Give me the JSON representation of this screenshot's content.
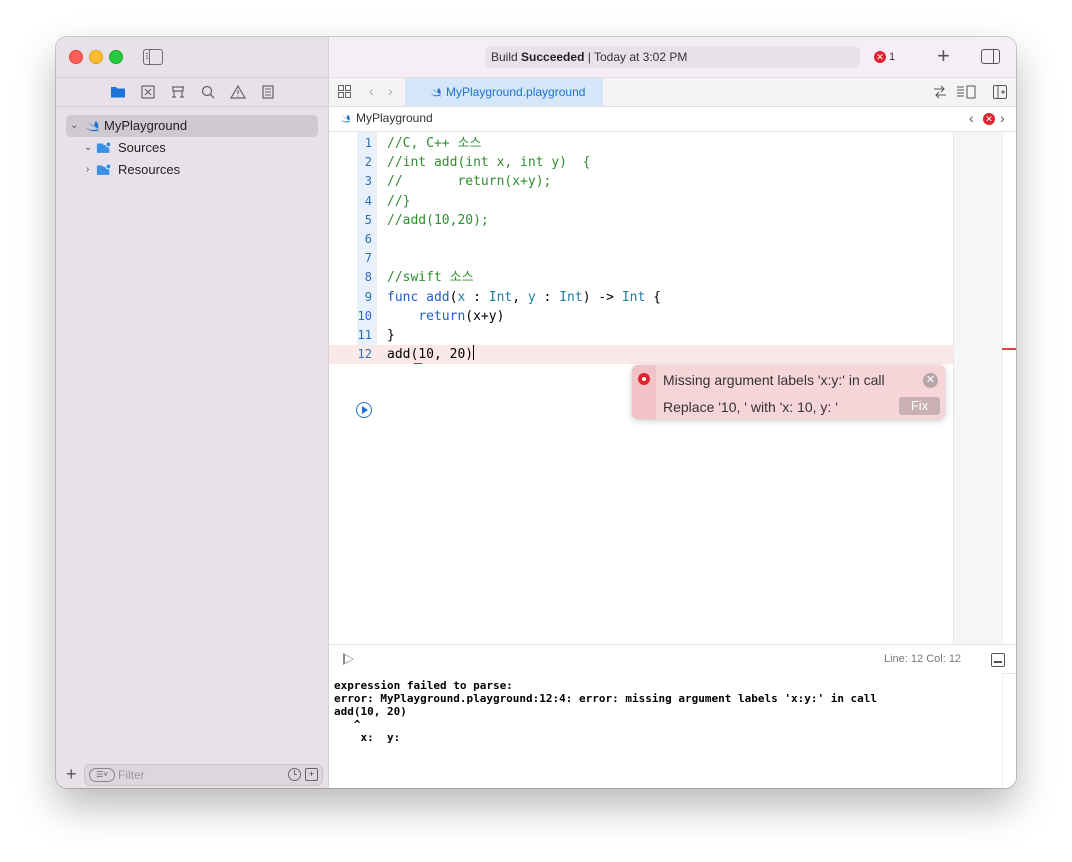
{
  "window": {
    "status": {
      "prefix": "Build ",
      "bold": "Succeeded",
      "suffix": " | Today at 3:02 PM"
    },
    "error_count": "1"
  },
  "sidebar": {
    "tree": [
      {
        "label": "MyPlayground",
        "icon": "swift-icon",
        "expanded": true,
        "selected": true
      },
      {
        "label": "Sources",
        "icon": "folder-icon",
        "expanded": true
      },
      {
        "label": "Resources",
        "icon": "folder-icon",
        "expanded": false
      }
    ],
    "filter_placeholder": "Filter",
    "nav_icons": [
      "project-navigator-icon",
      "source-control-icon",
      "symbol-navigator-icon",
      "find-icon",
      "issue-navigator-icon",
      "report-navigator-icon"
    ]
  },
  "tabbar": {
    "active_tab": "MyPlayground.playground"
  },
  "jumpbar": {
    "file": "MyPlayground"
  },
  "editor": {
    "lines": [
      {
        "n": "1",
        "text": "//C, C++ 소스",
        "kind": "comment"
      },
      {
        "n": "2",
        "text": "//int add(int x, int y)  {",
        "kind": "comment"
      },
      {
        "n": "3",
        "text": "//       return(x+y);",
        "kind": "comment"
      },
      {
        "n": "4",
        "text": "//}",
        "kind": "comment"
      },
      {
        "n": "5",
        "text": "//add(10,20);",
        "kind": "comment"
      },
      {
        "n": "6",
        "text": "",
        "kind": "plain"
      },
      {
        "n": "7",
        "text": "",
        "kind": "plain"
      },
      {
        "n": "8",
        "text": "//swift 소스",
        "kind": "comment"
      },
      {
        "n": "9",
        "text": "func add(x : Int, y : Int) -> Int {",
        "kind": "func"
      },
      {
        "n": "10",
        "text": "    return(x+y)",
        "kind": "return"
      },
      {
        "n": "11",
        "text": "}",
        "kind": "plain"
      },
      {
        "n": "12",
        "text": "add(10, 20)",
        "kind": "error"
      }
    ]
  },
  "issue": {
    "message": "Missing argument labels 'x:y:' in call",
    "fix_text": "Replace '10, ' with 'x: 10, y: '",
    "fix_label": "Fix"
  },
  "debug": {
    "position": "Line: 12  Col: 12"
  },
  "console": {
    "lines": [
      "expression failed to parse:",
      "error: MyPlayground.playground:12:4: error: missing argument labels 'x:y:' in call",
      "add(10, 20)",
      "   ^",
      "    x:  y: "
    ]
  },
  "colors": {
    "accent": "#1f73d6",
    "error": "#e0242f",
    "comment": "#2f8f2f"
  }
}
